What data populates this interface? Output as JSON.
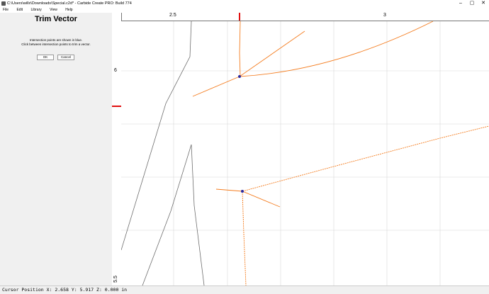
{
  "window": {
    "title": "C:\\Users\\willx\\Downloads\\Special.c2d* - Carbide Create PRO: Build 774",
    "controls": [
      "–",
      "▢",
      "✕"
    ]
  },
  "menu": {
    "items": [
      "File",
      "Edit",
      "Library",
      "View",
      "Help"
    ]
  },
  "panel": {
    "title": "Trim Vector",
    "line1": "Intersection points are shown in blue.",
    "line2": "Click between intersection points to trim a vector.",
    "ok_label": "OK",
    "cancel_label": "Cancel"
  },
  "rulers": {
    "h_labels": [
      "2.5",
      "3"
    ],
    "v_labels": [
      "6",
      "5.5"
    ]
  },
  "status": {
    "cursor": "Cursor Position X: 2.658 Y: 5.917 Z: 0.000 in"
  },
  "colors": {
    "vector_orange": "#f47d20",
    "vector_gray": "#6e6e6e",
    "grid": "#d8d8d8",
    "marker_red": "#e01010",
    "intersection_point": "#2a2aa0"
  }
}
